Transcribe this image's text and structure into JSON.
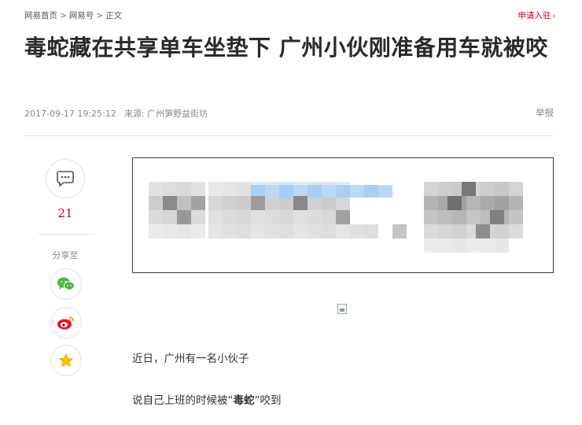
{
  "breadcrumb": {
    "items": [
      "网易首页",
      "网易号",
      "正文"
    ],
    "separator": ">"
  },
  "header": {
    "apply_link": "申请入驻",
    "apply_arrow_icon": "chevron-right-icon"
  },
  "article": {
    "title": "毒蛇藏在共享单车坐垫下 广州小伙刚准备用车就被咬",
    "timestamp": "2017-09-17 19:25:12",
    "source": "来源: 广州笋野益街坊",
    "report_label": "举报"
  },
  "share_rail": {
    "comment_icon": "comment-bubble-icon",
    "comment_count": "21",
    "share_label": "分享至",
    "share_targets": [
      "wechat-icon",
      "weibo-icon",
      "favorite-star-icon"
    ]
  },
  "content": {
    "paragraph1": "近日，广州有一名小伙子",
    "paragraph2_before": "说自己上班的时候被“",
    "paragraph2_bold": "毒蛇",
    "paragraph2_after": "”咬到"
  },
  "colors": {
    "accent_red": "#c0081b",
    "link_red": "#d0021b",
    "meta_gray": "#888888",
    "wechat_green": "#4cb848",
    "weibo_red": "#e6162d",
    "star_gold": "#f5c400"
  }
}
